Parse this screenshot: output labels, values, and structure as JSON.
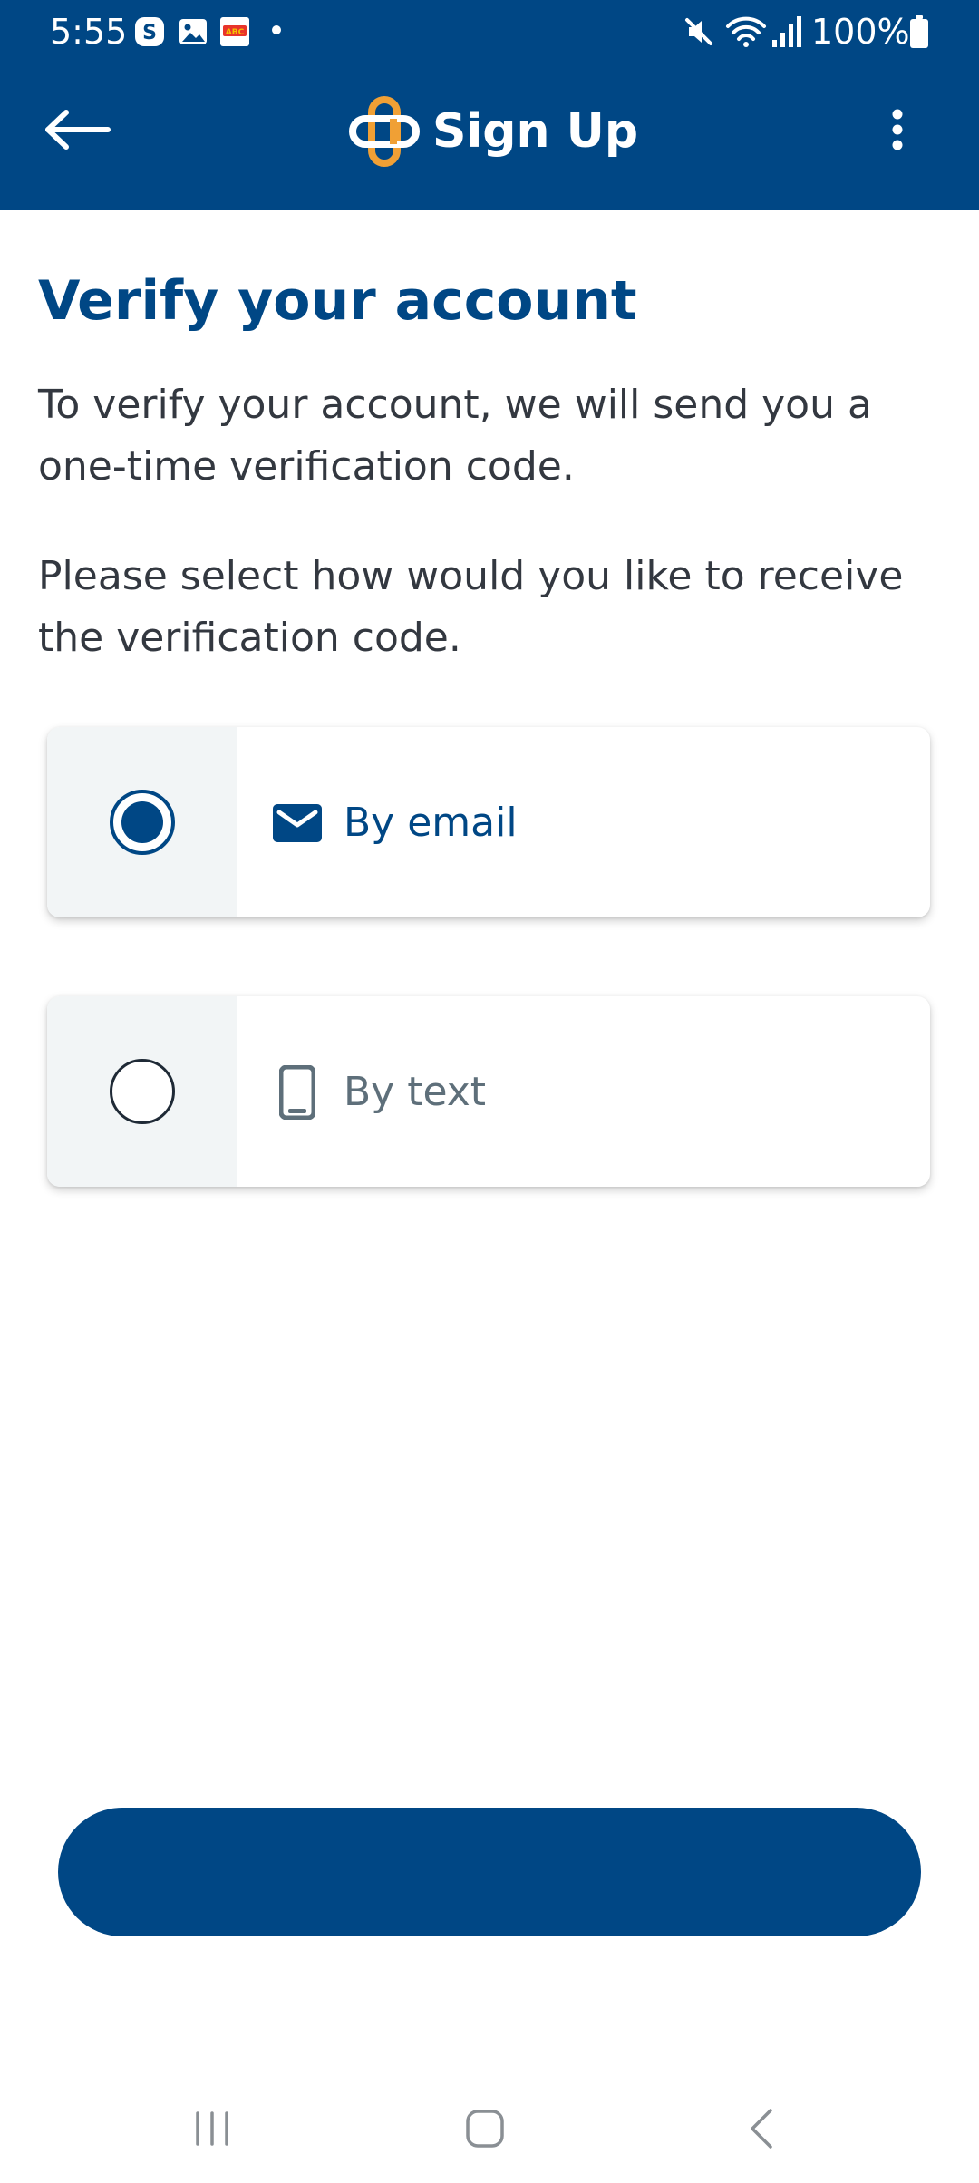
{
  "status_bar": {
    "time": "5:55",
    "battery": "100%",
    "icons": [
      "s-app-icon",
      "gallery-icon",
      "app-notification-icon",
      "mute-icon",
      "wifi-icon",
      "signal-icon",
      "battery-icon"
    ]
  },
  "app_bar": {
    "title": "Sign Up",
    "back_icon": "arrow-left-icon",
    "logo_icon": "cross-logo-icon",
    "menu_icon": "more-vertical-icon"
  },
  "content": {
    "heading": "Verify your account",
    "paragraph_1": "To verify your account, we will send you a one-time verification code.",
    "paragraph_2": "Please select how would you like to receive the verification code."
  },
  "options": [
    {
      "label": "By email",
      "icon": "email-icon",
      "selected": true
    },
    {
      "label": "By text",
      "icon": "phone-icon",
      "selected": false
    }
  ],
  "primary_button": {
    "label": ""
  },
  "navigation_bar": {
    "icons": [
      "recents-icon",
      "home-icon",
      "back-icon"
    ]
  },
  "colors": {
    "brand_blue": "#004785",
    "brand_orange": "#f0a035",
    "text_dark": "#333840",
    "muted": "#5e6f7a",
    "radio_cell_bg": "#f2f5f6"
  }
}
